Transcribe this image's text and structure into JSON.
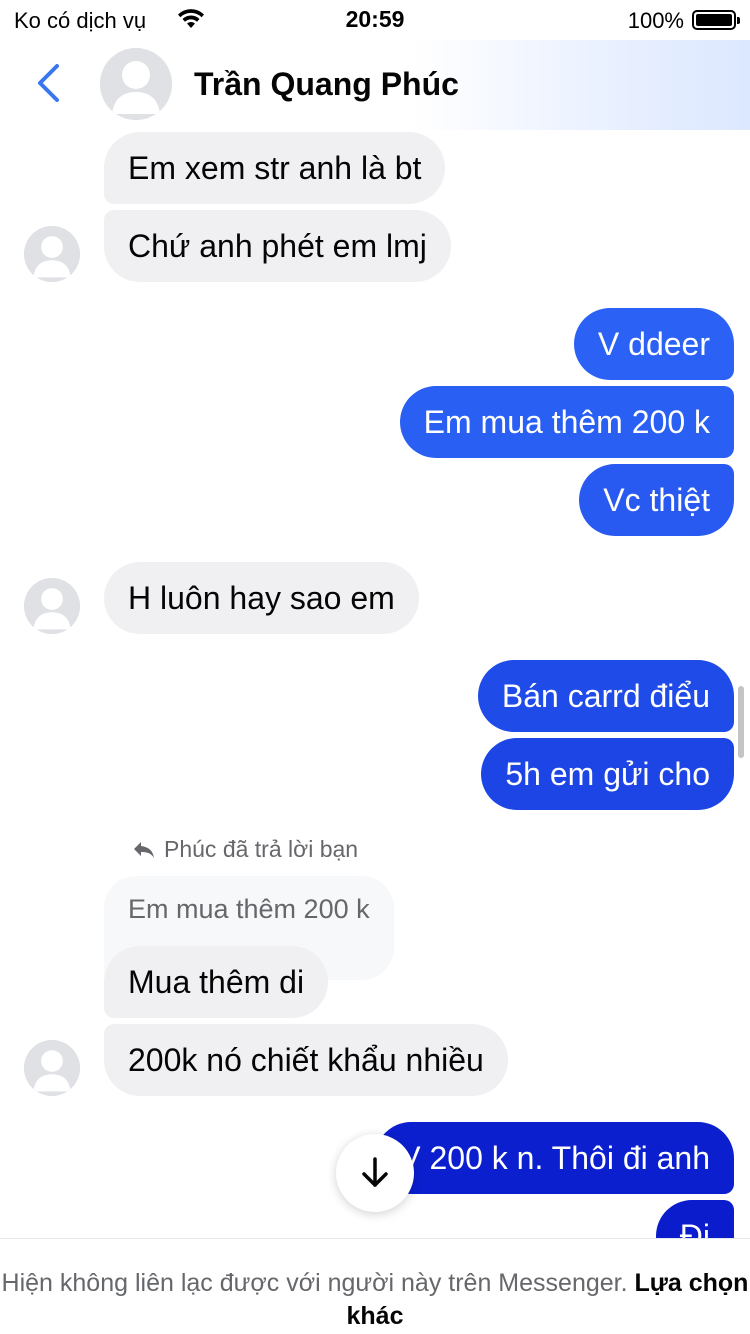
{
  "status_bar": {
    "carrier": "Ko có dịch vụ",
    "time": "20:59",
    "battery": "100%"
  },
  "header": {
    "contact_name": "Trần Quang Phúc"
  },
  "colors": {
    "accent": "#3a76f0",
    "outgoing_blue_light": "#2b62f5",
    "outgoing_blue_dark": "#0b1fcf",
    "incoming_bg": "#f0f0f3"
  },
  "messages": [
    {
      "direction": "in",
      "text": "Em xem str anh là bt"
    },
    {
      "direction": "in",
      "text": "Chứ anh phét em lmj"
    },
    {
      "direction": "out",
      "text": "V ddeer"
    },
    {
      "direction": "out",
      "text": "Em mua thêm 200 k"
    },
    {
      "direction": "out",
      "text": "Vc thiệt"
    },
    {
      "direction": "in",
      "text": "H luôn hay sao em"
    },
    {
      "direction": "out",
      "text": "Bán carrd điểu"
    },
    {
      "direction": "out",
      "text": "5h em gửi cho"
    },
    {
      "direction": "in",
      "text": "Mua thêm di"
    },
    {
      "direction": "in",
      "text": "200k nó chiết khẩu nhiều"
    },
    {
      "direction": "out",
      "text": "V 200 k n. Thôi đi anh"
    },
    {
      "direction": "out",
      "text": "Đi"
    }
  ],
  "reply": {
    "label": "Phúc đã trả lời bạn",
    "quoted_text": "Em mua thêm 200 k"
  },
  "footer": {
    "notice": "Hiện không liên lạc được với người này trên Messenger.",
    "link": "Lựa chọn khác"
  },
  "icons": {
    "back": "chevron-left-icon",
    "wifi": "wifi-icon",
    "reply": "reply-arrow-icon",
    "scroll_down": "arrow-down-icon"
  }
}
